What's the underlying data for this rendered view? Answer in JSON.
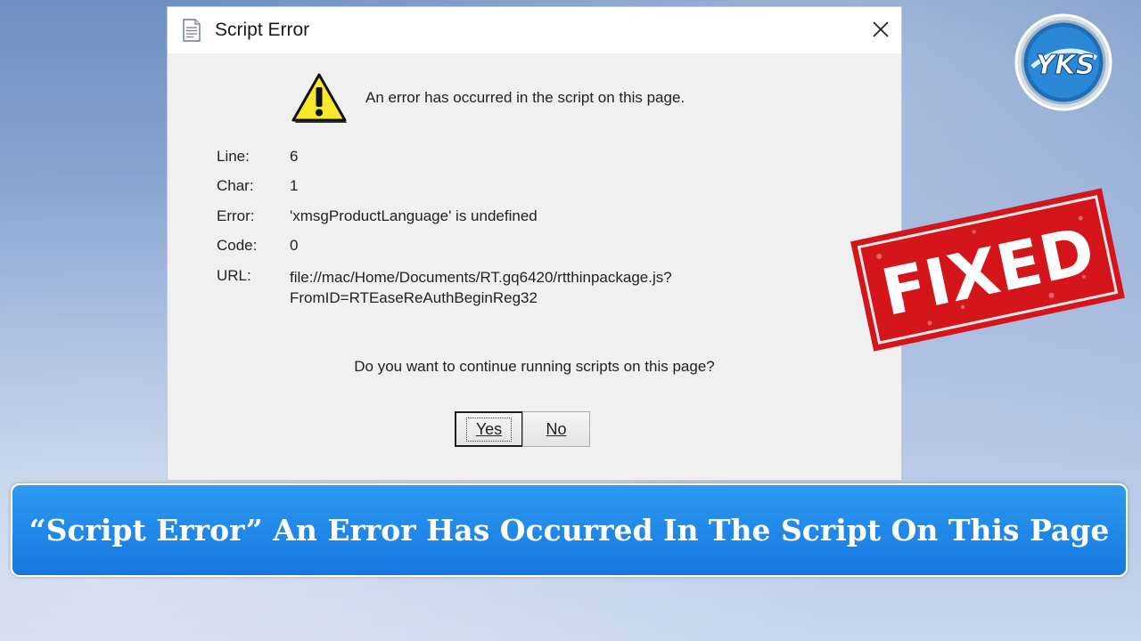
{
  "dialog": {
    "title": "Script Error",
    "message": "An error has occurred in the script on this page.",
    "details": {
      "line_label": "Line:",
      "line_value": "6",
      "char_label": "Char:",
      "char_value": "1",
      "error_label": "Error:",
      "error_value": "'xmsgProductLanguage' is undefined",
      "code_label": "Code:",
      "code_value": "0",
      "url_label": "URL:",
      "url_value_line1": "file://mac/Home/Documents/RT.gq6420/rtthinpackage.js?",
      "url_value_line2": "FromID=RTEaseReAuthBeginReg32"
    },
    "question": "Do you want to continue running scripts on this page?",
    "yes_label": "Yes",
    "no_label": "No"
  },
  "stamp": {
    "text": "FIXED",
    "color": "#d4161c"
  },
  "logo": {
    "text": "YKS",
    "icon": "yks-logo"
  },
  "banner": {
    "text": "“Script Error” An Error Has Occurred In The Script On This Page",
    "color": "#1677e0"
  }
}
